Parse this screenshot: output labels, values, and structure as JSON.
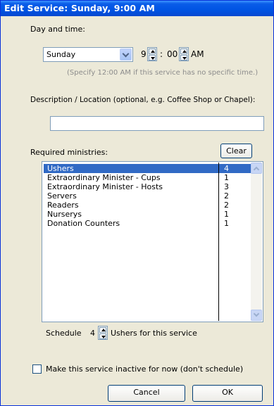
{
  "window": {
    "title": "Edit Service: Sunday, 9:00 AM"
  },
  "day_time": {
    "label": "Day and time:",
    "day_value": "Sunday",
    "hour_value": "9",
    "separator": ":",
    "minute_value": "00",
    "ampm_value": "AM",
    "hint": "(Specify 12:00 AM if this service has no specific time.)"
  },
  "description": {
    "label": "Description / Location (optional, e.g. Coffee Shop or Chapel):",
    "value": ""
  },
  "ministries": {
    "label": "Required ministries:",
    "clear_label": "Clear",
    "items": [
      {
        "name": "Ushers",
        "count": "4",
        "selected": true
      },
      {
        "name": "Extraordinary Minister - Cups",
        "count": "1"
      },
      {
        "name": "Extraordinary Minister - Hosts",
        "count": "3"
      },
      {
        "name": "Servers",
        "count": "2"
      },
      {
        "name": "Readers",
        "count": "2"
      },
      {
        "name": "Nurserys",
        "count": "1"
      },
      {
        "name": "Donation Counters",
        "count": "1"
      }
    ]
  },
  "schedule": {
    "prefix": "Schedule",
    "value": "4",
    "suffix": "Ushers for this service"
  },
  "inactive": {
    "label": "Make this service inactive for now (don't schedule)",
    "checked": false
  },
  "buttons": {
    "cancel": "Cancel",
    "ok": "OK"
  },
  "colors": {
    "title_bar": "#0054e3",
    "dialog_bg": "#ece9d8",
    "selection": "#316ac5"
  }
}
